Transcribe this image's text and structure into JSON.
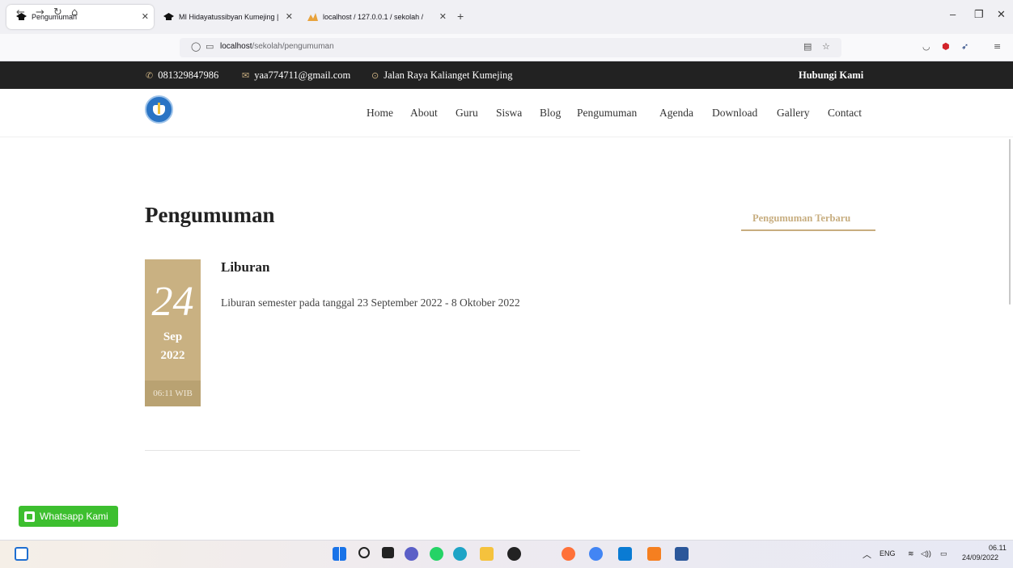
{
  "browser": {
    "tabs": [
      {
        "title": "Pengumuman",
        "active": true
      },
      {
        "title": "MI Hidayatussibyan Kumejing |",
        "active": false
      },
      {
        "title": "localhost / 127.0.0.1 / sekolah /",
        "active": false
      }
    ],
    "url_host": "localhost",
    "url_path": "/sekolah/pengumuman",
    "icons": [
      "back-arrow-icon",
      "forward-arrow-icon",
      "reload-icon",
      "home-icon",
      "shield-icon",
      "page-icon",
      "reader-view-icon",
      "bookmark-star-icon",
      "pocket-icon",
      "ublock-icon",
      "extension-icon",
      "menu-icon"
    ]
  },
  "topbar": {
    "phone": "081329847986",
    "email": "yaa774711@gmail.com",
    "address": "Jalan Raya Kalianget Kumejing",
    "contact_label": "Hubungi Kami"
  },
  "nav": {
    "items": [
      "Home",
      "About",
      "Guru",
      "Siswa",
      "Blog",
      "Pengumuman",
      "Agenda",
      "Download",
      "Gallery",
      "Contact"
    ]
  },
  "page": {
    "title": "Pengumuman",
    "sidebar_title": "Pengumuman Terbaru"
  },
  "post": {
    "day": "24",
    "month": "Sep",
    "year": "2022",
    "time": "06:11 WIB",
    "title": "Liburan",
    "body": "Liburan semester pada tanggal 23 September 2022 - 8 Oktober 2022"
  },
  "whatsapp": {
    "label": "Whatsapp Kami",
    "color": "#3dbf2f"
  },
  "taskbar": {
    "lang": "ENG",
    "time": "06.11",
    "date": "24/09/2022"
  },
  "colors": {
    "accent_gold": "#c7ad7f",
    "topbar_bg": "#222222"
  }
}
